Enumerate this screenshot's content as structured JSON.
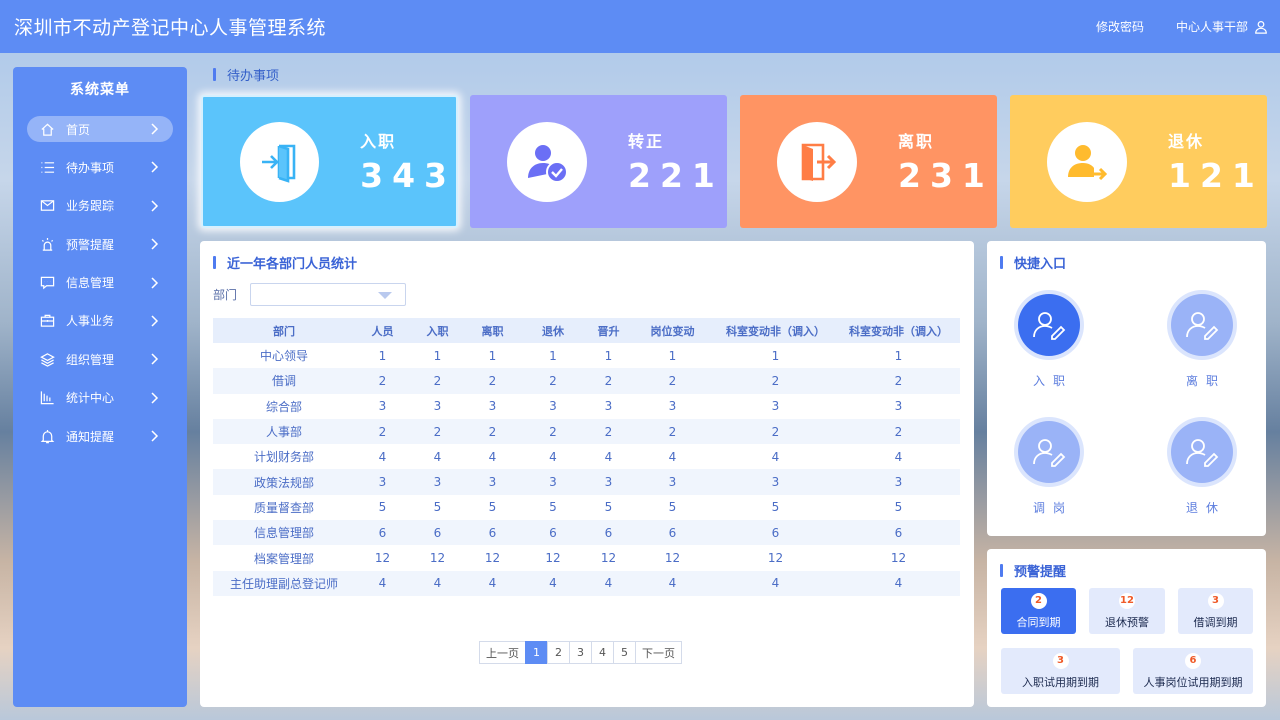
{
  "header": {
    "title": "深圳市不动产登记中心人事管理系统",
    "change_password": "修改密码",
    "user": "中心人事干部",
    "user_icon": "user-icon"
  },
  "sidebar": {
    "title": "系统菜单",
    "items": [
      {
        "label": "首页",
        "icon": "home-icon",
        "active": true
      },
      {
        "label": "待办事项",
        "icon": "list-icon"
      },
      {
        "label": "业务跟踪",
        "icon": "mail-icon"
      },
      {
        "label": "预警提醒",
        "icon": "alarm-icon"
      },
      {
        "label": "信息管理",
        "icon": "message-icon"
      },
      {
        "label": "人事业务",
        "icon": "briefcase-icon"
      },
      {
        "label": "组织管理",
        "icon": "layers-icon"
      },
      {
        "label": "统计中心",
        "icon": "bar-chart-icon"
      },
      {
        "label": "通知提醒",
        "icon": "bell-icon"
      }
    ]
  },
  "pending": {
    "title": "待办事项",
    "cards": [
      {
        "label": "入职",
        "value": "343",
        "color": "#5bc4fb",
        "icon": "enter-door-icon"
      },
      {
        "label": "转正",
        "value": "221",
        "color": "#9ea0fb",
        "icon": "user-check-icon"
      },
      {
        "label": "离职",
        "value": "231",
        "color": "#ff9463",
        "icon": "exit-door-icon"
      },
      {
        "label": "退休",
        "value": "121",
        "color": "#ffcc5e",
        "icon": "user-leave-icon"
      }
    ]
  },
  "dept_stats": {
    "title": "近一年各部门人员统计",
    "filter_label": "部门",
    "filter_value": "",
    "columns": [
      "部门",
      "人员",
      "入职",
      "离职",
      "退休",
      "晋升",
      "岗位变动",
      "科室变动非（调入）",
      "科室变动非（调入）"
    ],
    "rows": [
      [
        "中心领导",
        "1",
        "1",
        "1",
        "1",
        "1",
        "1",
        "1",
        "1"
      ],
      [
        "借调",
        "2",
        "2",
        "2",
        "2",
        "2",
        "2",
        "2",
        "2"
      ],
      [
        "综合部",
        "3",
        "3",
        "3",
        "3",
        "3",
        "3",
        "3",
        "3"
      ],
      [
        "人事部",
        "2",
        "2",
        "2",
        "2",
        "2",
        "2",
        "2",
        "2"
      ],
      [
        "计划财务部",
        "4",
        "4",
        "4",
        "4",
        "4",
        "4",
        "4",
        "4"
      ],
      [
        "政策法规部",
        "3",
        "3",
        "3",
        "3",
        "3",
        "3",
        "3",
        "3"
      ],
      [
        "质量督查部",
        "5",
        "5",
        "5",
        "5",
        "5",
        "5",
        "5",
        "5"
      ],
      [
        "信息管理部",
        "6",
        "6",
        "6",
        "6",
        "6",
        "6",
        "6",
        "6"
      ],
      [
        "档案管理部",
        "12",
        "12",
        "12",
        "12",
        "12",
        "12",
        "12",
        "12"
      ],
      [
        "主任助理副总登记师",
        "4",
        "4",
        "4",
        "4",
        "4",
        "4",
        "4",
        "4"
      ]
    ],
    "pager": {
      "prev": "上一页",
      "pages": [
        "1",
        "2",
        "3",
        "4",
        "5"
      ],
      "current": "1",
      "next": "下一页"
    }
  },
  "quick": {
    "title": "快捷入口",
    "items": [
      {
        "label": "入职",
        "icon": "user-edit-icon",
        "primary": true
      },
      {
        "label": "离职",
        "icon": "user-edit-icon"
      },
      {
        "label": "调岗",
        "icon": "user-edit-icon"
      },
      {
        "label": "退休",
        "icon": "user-edit-icon"
      }
    ]
  },
  "warnings": {
    "title": "预警提醒",
    "items": [
      {
        "count": "2",
        "label": "合同到期",
        "active": true
      },
      {
        "count": "12",
        "label": "退休预警"
      },
      {
        "count": "3",
        "label": "借调到期"
      },
      {
        "count": "3",
        "label": "入职试用期到期"
      },
      {
        "count": "6",
        "label": "人事岗位试用期到期"
      }
    ]
  },
  "colors": {
    "primary": "#5d8cf4",
    "accent": "#3b6ef0",
    "badge_text": "#f05a28"
  }
}
